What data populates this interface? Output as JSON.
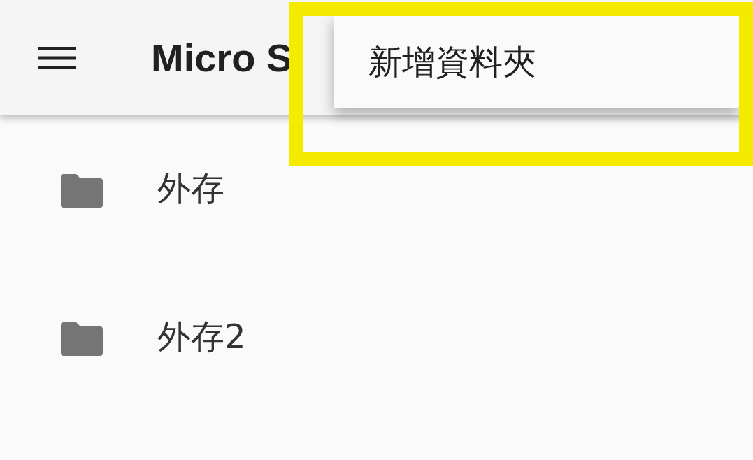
{
  "app_bar": {
    "title": "Micro S"
  },
  "menu": {
    "items": [
      {
        "label": "新增資料夾"
      }
    ],
    "highlighted": true
  },
  "folders": [
    {
      "name": "外存"
    },
    {
      "name": "外存2"
    }
  ]
}
